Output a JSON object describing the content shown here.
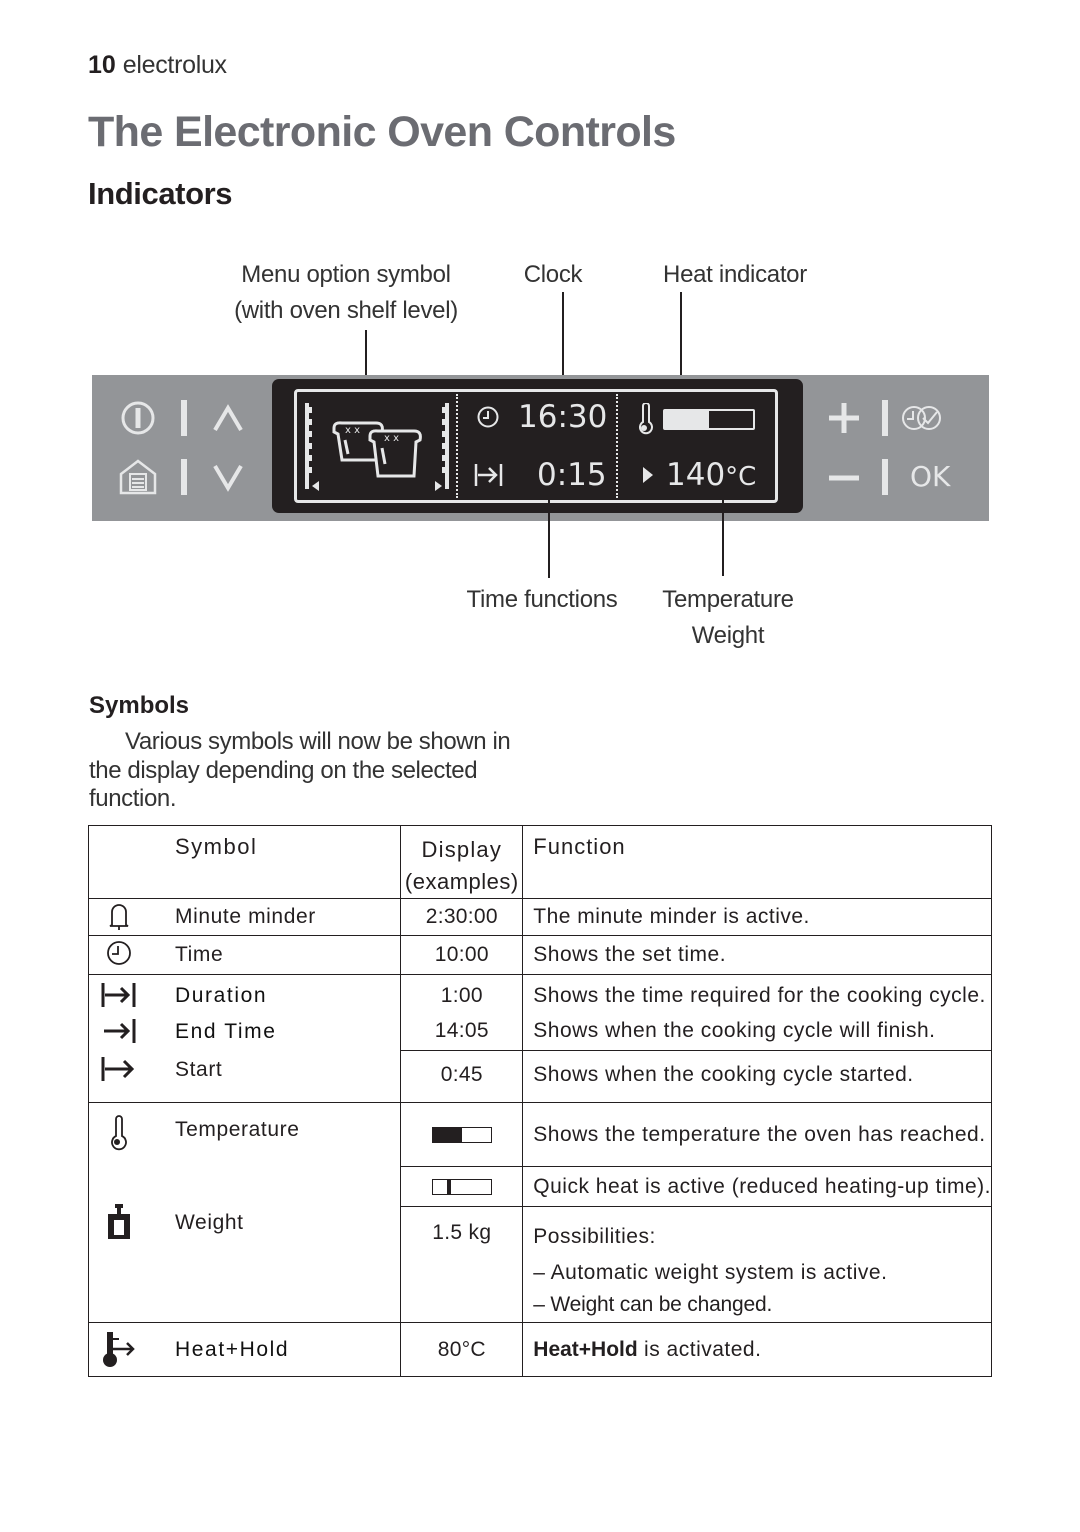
{
  "page_header": {
    "page_number": "10",
    "brand": "electrolux"
  },
  "title": "The Electronic Oven Controls",
  "subtitle": "Indicators",
  "diagram": {
    "callouts_top": {
      "menu_option_line1": "Menu option symbol",
      "menu_option_line2": "(with oven shelf level)",
      "clock": "Clock",
      "heat_indicator": "Heat indicator"
    },
    "callouts_bottom": {
      "time_functions": "Time functions",
      "temperature": "Temperature",
      "weight": "Weight"
    },
    "display": {
      "clock_time": "16:30",
      "duration_value": "0:15",
      "temperature_value": "140",
      "temperature_unit": "°C",
      "heat_indicator_fill": 0.5
    },
    "buttons": {
      "ok_label": "OK",
      "plus_label": "+",
      "minus_label": "–",
      "up_label": "∧",
      "down_label": "∨"
    },
    "colors": {
      "panel": "#939598",
      "screen": "#231f20",
      "lcd": "#e6e7e8"
    }
  },
  "symbols_section": {
    "heading": "Symbols",
    "intro": "Various symbols will now be shown in the display depending on the selected function."
  },
  "table": {
    "headers": {
      "symbol": "Symbol",
      "display_line1": "Display",
      "display_line2": "(examples)",
      "function": "Function"
    },
    "rows": [
      {
        "icon": "bell-icon",
        "symbol": "Minute minder",
        "display": "2:30:00",
        "function": "The minute minder is active."
      },
      {
        "icon": "clock-icon",
        "symbol": "Time",
        "display": "10:00",
        "function": "Shows the set time."
      },
      {
        "icon": "duration-icon",
        "symbol": "Duration",
        "display": "1:00",
        "function": "Shows the time required for the cooking cycle."
      },
      {
        "icon": "end-time-icon",
        "symbol": "End Time",
        "display": "14:05",
        "function": "Shows when the cooking cycle will finish."
      },
      {
        "icon": "start-icon",
        "symbol": "Start",
        "display": "0:45",
        "function": "Shows when the cooking cycle started."
      },
      {
        "icon": "thermometer-icon",
        "symbol": "Temperature",
        "display_bar_fill": 0.5,
        "function": "Shows the temperature the oven has reached."
      },
      {
        "display_bar_marker": 0.25,
        "function": "Quick heat is active (reduced heating-up time)."
      },
      {
        "icon": "weight-icon",
        "symbol": "Weight",
        "display": "1.5 kg",
        "function": "Possibilities:",
        "function_items": [
          "– Automatic weight system is active.",
          "– Weight can be changed."
        ]
      },
      {
        "icon": "heat-hold-icon",
        "symbol": "Heat+Hold",
        "display": "80°C",
        "function_bold": "Heat+Hold",
        "function": " is activated."
      }
    ]
  }
}
